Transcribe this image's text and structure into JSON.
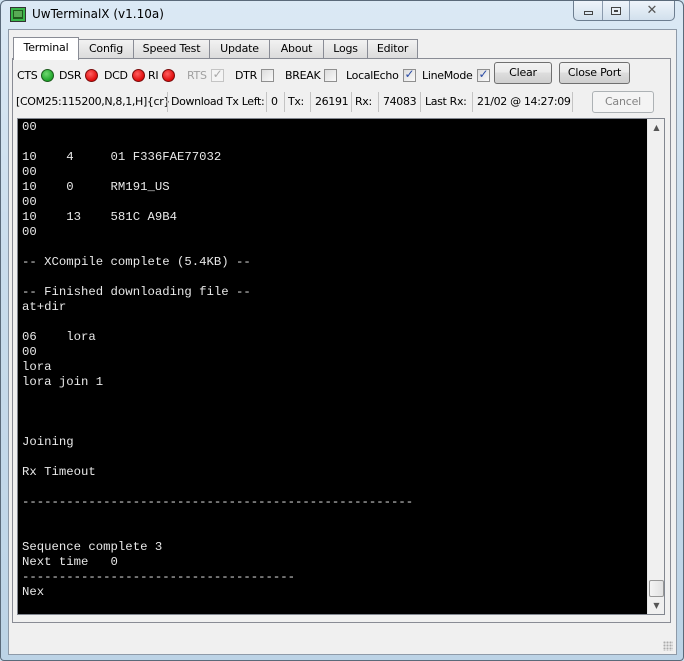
{
  "window": {
    "title": "UwTerminalX (v1.10a)",
    "controls": {
      "minimize": "minimize",
      "maximize": "maximize",
      "close": "✕"
    }
  },
  "tabs": [
    {
      "label": "Terminal",
      "active": true
    },
    {
      "label": "Config",
      "active": false
    },
    {
      "label": "Speed Test",
      "active": false
    },
    {
      "label": "Update",
      "active": false
    },
    {
      "label": "About",
      "active": false
    },
    {
      "label": "Logs",
      "active": false
    },
    {
      "label": "Editor",
      "active": false
    }
  ],
  "signals": {
    "cts": {
      "label": "CTS",
      "state": "on",
      "color": "#1fa52a"
    },
    "dsr": {
      "label": "DSR",
      "state": "off",
      "color": "#e00c0c"
    },
    "dcd": {
      "label": "DCD",
      "state": "off",
      "color": "#e00c0c"
    },
    "ri": {
      "label": "RI",
      "state": "off",
      "color": "#e00c0c"
    }
  },
  "options": {
    "rts": {
      "label": "RTS",
      "checked": true,
      "enabled": false
    },
    "dtr": {
      "label": "DTR",
      "checked": false,
      "enabled": true
    },
    "break": {
      "label": "BREAK",
      "checked": false,
      "enabled": true
    },
    "local_echo": {
      "label": "LocalEcho",
      "checked": true,
      "enabled": true
    },
    "line_mode": {
      "label": "LineMode",
      "checked": true,
      "enabled": true
    }
  },
  "buttons": {
    "clear": "Clear",
    "close_port": "Close Port",
    "cancel": "Cancel"
  },
  "status": {
    "port_settings": "[COM25:115200,N,8,1,H]{cr}",
    "download_tx_left_label": "Download Tx Left:",
    "download_tx_left_value": "0",
    "tx_label": "Tx:",
    "tx_value": "26191",
    "rx_label": "Rx:",
    "rx_value": "74083",
    "last_rx_label": "Last Rx:",
    "last_rx_value": "21/02 @ 14:27:09"
  },
  "terminal": {
    "lines": [
      "00",
      "",
      "10    4     01 F336FAE77032",
      "00",
      "10    0     RM191_US",
      "00",
      "10    13    581C A9B4",
      "00",
      "",
      "-- XCompile complete (5.4KB) --",
      "",
      "-- Finished downloading file --",
      "at+dir",
      "",
      "06    lora",
      "00",
      "lora",
      "lora join 1",
      "",
      "",
      "",
      "Joining",
      "",
      "Rx Timeout",
      "",
      "-----------------------------------------------------",
      "",
      "",
      "Sequence complete 3",
      "Next time   0",
      "-------------------------------------",
      "Nex"
    ],
    "scroll_position": 1.0
  }
}
